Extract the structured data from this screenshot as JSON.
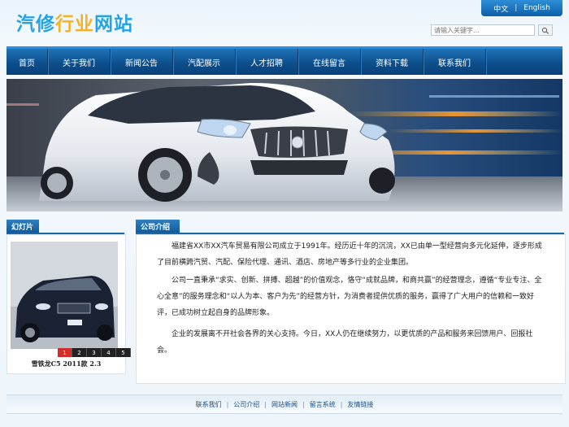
{
  "header": {
    "logo_part1": "汽修",
    "logo_part2": "行业",
    "logo_part3": "网站",
    "lang_cn": "中文",
    "lang_sep": "|",
    "lang_en": "English",
    "search_placeholder": "请输入关键字..."
  },
  "nav": {
    "items": [
      "首页",
      "关于我们",
      "新闻公告",
      "汽配展示",
      "人才招聘",
      "在线留言",
      "资料下载",
      "联系我们"
    ]
  },
  "slideshow": {
    "title": "幻灯片",
    "numbers": [
      "1",
      "2",
      "3",
      "4",
      "5"
    ],
    "active": 1,
    "caption": "雪铁龙C5 2011款 2.3"
  },
  "intro": {
    "title": "公司介绍",
    "para1": "福建省XX市XX汽车贸易有限公司成立于1991年。经历近十年的沉浣，XX已由单一型经营向多元化延伸，逐步形成了目前横跨汽贸、汽配、保险代理、通讯、酒店、房地产等多行业的企业集团。",
    "para2": "公司一直秉承“求实、创新、拼搏、超越”的价值观念，恪守“成就品牌，和商共赢”的经营理念，遵循“专业专注、全心全意”的服务理念和“以人为本、客户为先”的经营方针，为消费者提供优质的服务，赢得了广大用户的信赖和一致好评，已成功树立起自身的品牌形象。",
    "para3": "企业的发展离不开社会各界的关心支持。今日，XX人仍在继续努力，以更优质的产品和服务来回馈用户、回报社会。"
  },
  "footer": {
    "links": [
      "联系我们",
      "公司介绍",
      "网站新闻",
      "留言系统",
      "友情链接"
    ],
    "sep": "|"
  },
  "colors": {
    "nav": "#0d4f8c",
    "logo_blue": "#23a4e6",
    "logo_orange": "#f7b21f",
    "panel_head": "#1f6db0"
  }
}
